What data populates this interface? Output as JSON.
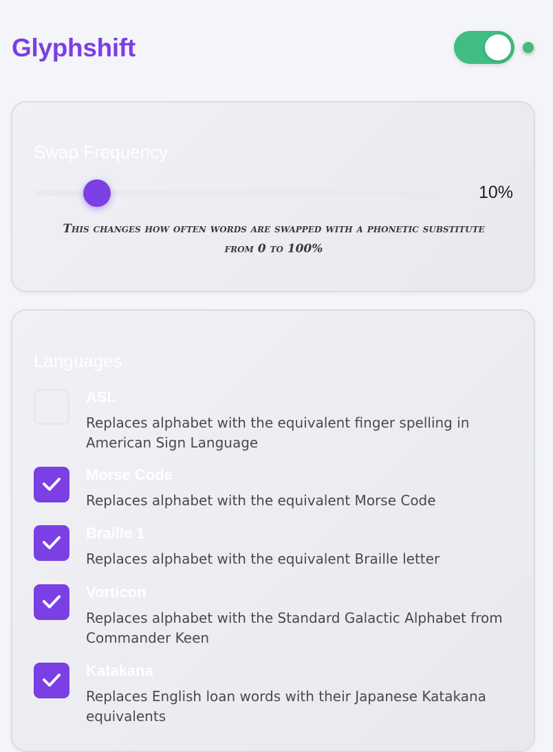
{
  "app": {
    "title": "Glyphshift",
    "enabled": true,
    "colors": {
      "accent": "#7b3fe4",
      "active": "#3fbd82"
    }
  },
  "frequency": {
    "heading": "Swap Frequency",
    "value": 10,
    "value_label": "10%",
    "hint": "This changes how often words are swapped with a phonetic substitute from 0 to 100%"
  },
  "languages": {
    "heading": "Languages",
    "items": [
      {
        "name": "ASL",
        "description": "Replaces alphabet with the equivalent finger spelling in American Sign Language",
        "checked": false
      },
      {
        "name": "Morse Code",
        "description": "Replaces alphabet with the equivalent Morse Code",
        "checked": true
      },
      {
        "name": "Braille 1",
        "description": "Replaces alphabet with the equivalent Braille letter",
        "checked": true
      },
      {
        "name": "Vorticon",
        "description": "Replaces alphabet with the Standard Galactic Alphabet from Commander Keen",
        "checked": true
      },
      {
        "name": "Katakana",
        "description": "Replaces English loan words with their Japanese Katakana equivalents",
        "checked": true
      }
    ]
  }
}
